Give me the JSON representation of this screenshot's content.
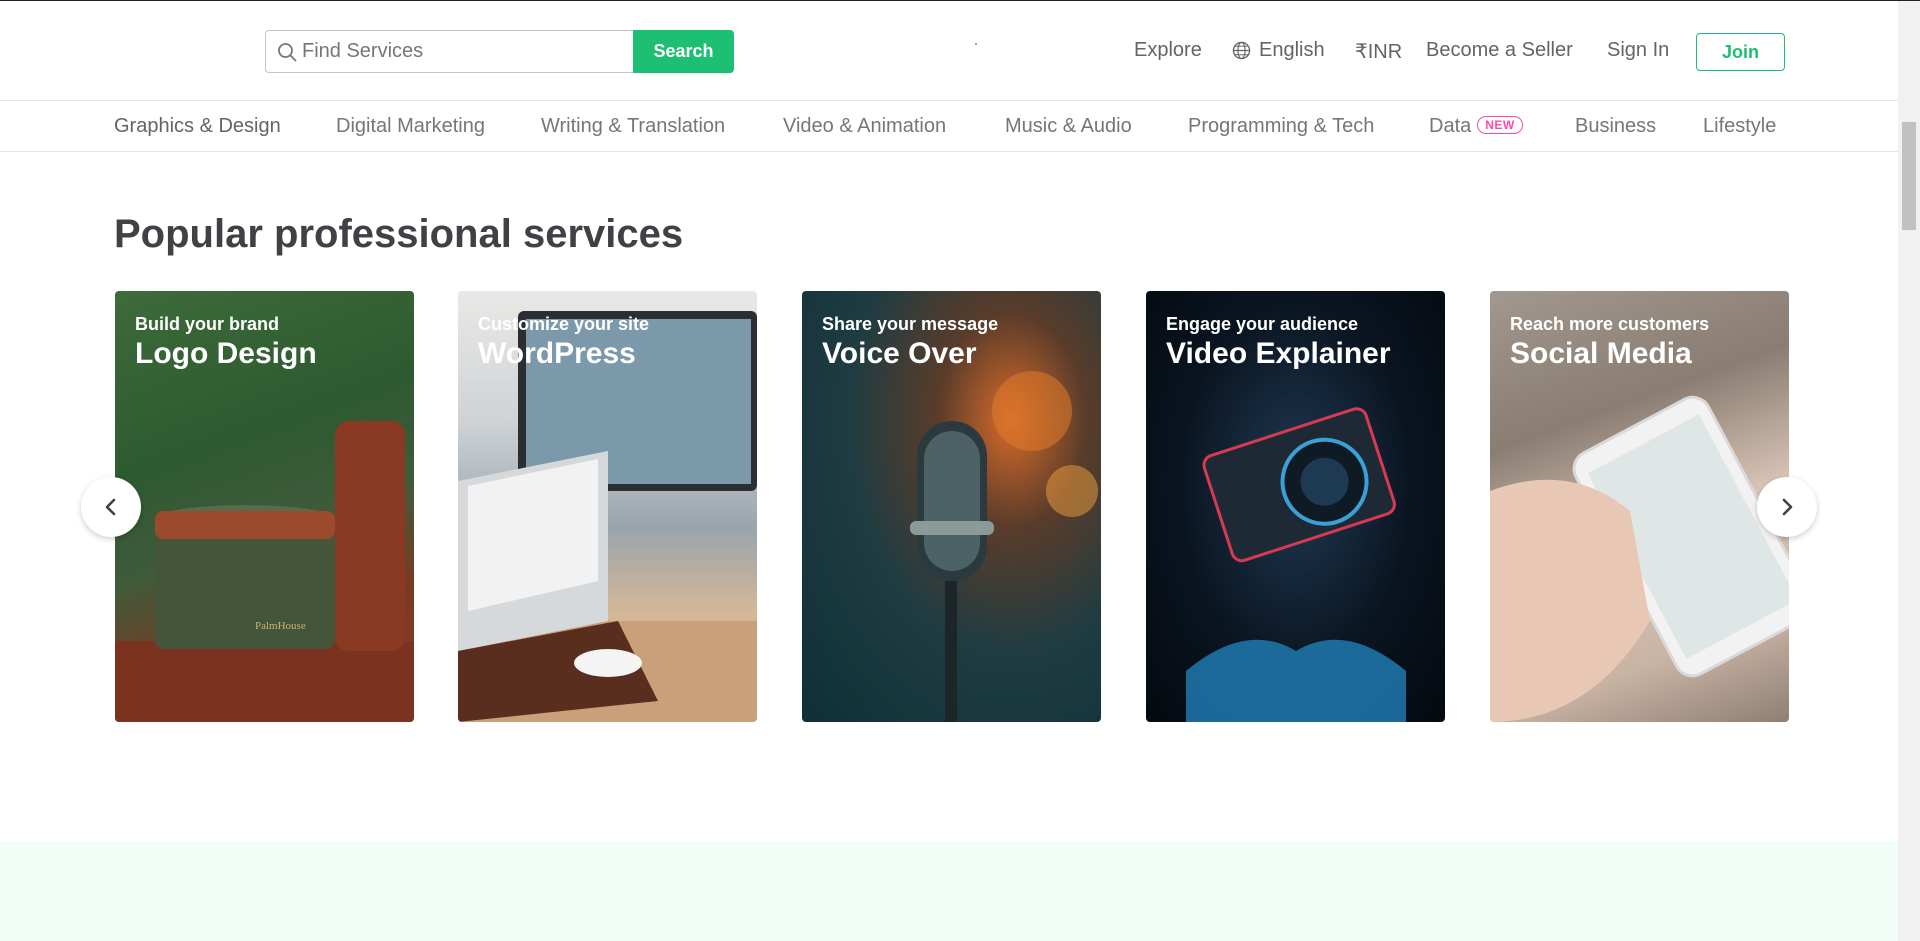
{
  "header": {
    "search_placeholder": "Find Services",
    "search_button": "Search",
    "nav": {
      "explore": "Explore",
      "language": "English",
      "currency": "₹INR",
      "become_seller": "Become a Seller",
      "sign_in": "Sign In",
      "join": "Join"
    }
  },
  "categories": [
    {
      "label": "Graphics & Design"
    },
    {
      "label": "Digital Marketing"
    },
    {
      "label": "Writing & Translation"
    },
    {
      "label": "Video & Animation"
    },
    {
      "label": "Music & Audio"
    },
    {
      "label": "Programming & Tech"
    },
    {
      "label": "Data",
      "badge": "NEW"
    },
    {
      "label": "Business"
    },
    {
      "label": "Lifestyle"
    }
  ],
  "section": {
    "title": "Popular professional services"
  },
  "cards": [
    {
      "subtitle": "Build your brand",
      "title": "Logo Design"
    },
    {
      "subtitle": "Customize your site",
      "title": "WordPress"
    },
    {
      "subtitle": "Share your message",
      "title": "Voice Over"
    },
    {
      "subtitle": "Engage your audience",
      "title": "Video Explainer"
    },
    {
      "subtitle": "Reach more customers",
      "title": "Social Media"
    }
  ],
  "colors": {
    "brand_green": "#1dbf73",
    "badge_pink": "#ff4aa7",
    "mint_band": "#f1fdf7"
  },
  "icons": {
    "search": "search-icon",
    "globe": "globe-icon",
    "carousel_prev": "chevron-left-icon",
    "carousel_next": "chevron-right-icon"
  }
}
